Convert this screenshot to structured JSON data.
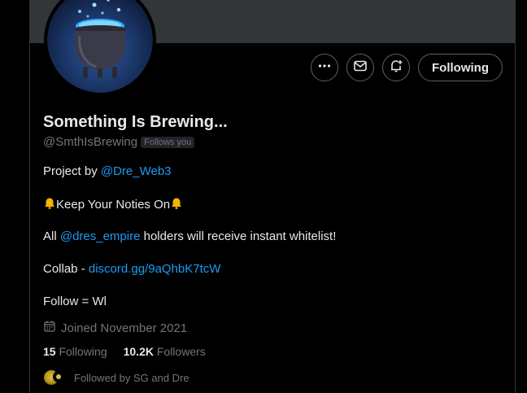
{
  "profile": {
    "name": "Something Is Brewing...",
    "handle": "@SmthIsBrewing",
    "follows_you": "Follows you",
    "bio": {
      "line1_prefix": "Project by ",
      "line1_link": "@Dre_Web3",
      "line2_text": "Keep Your Noties On",
      "line3_prefix": "All ",
      "line3_link": "@dres_empire",
      "line3_suffix": " holders will receive instant whitelist!",
      "line4_prefix": "Collab - ",
      "line4_link": "discord.gg/9aQhbK7tcW",
      "line5": "Follow = Wl"
    },
    "joined": "Joined November 2021",
    "following_count": "15",
    "following_label": "Following",
    "followers_count": "10.2K",
    "followers_label": "Followers",
    "followed_by": "Followed by SG and Dre"
  },
  "actions": {
    "following_button": "Following"
  },
  "icons": {
    "more": "more-icon",
    "message": "envelope-icon",
    "notify": "bell-plus-icon",
    "calendar": "calendar-icon"
  },
  "colors": {
    "background": "#000000",
    "banner": "#333639",
    "link": "#1d9bf0",
    "secondary_text": "#71767b"
  }
}
